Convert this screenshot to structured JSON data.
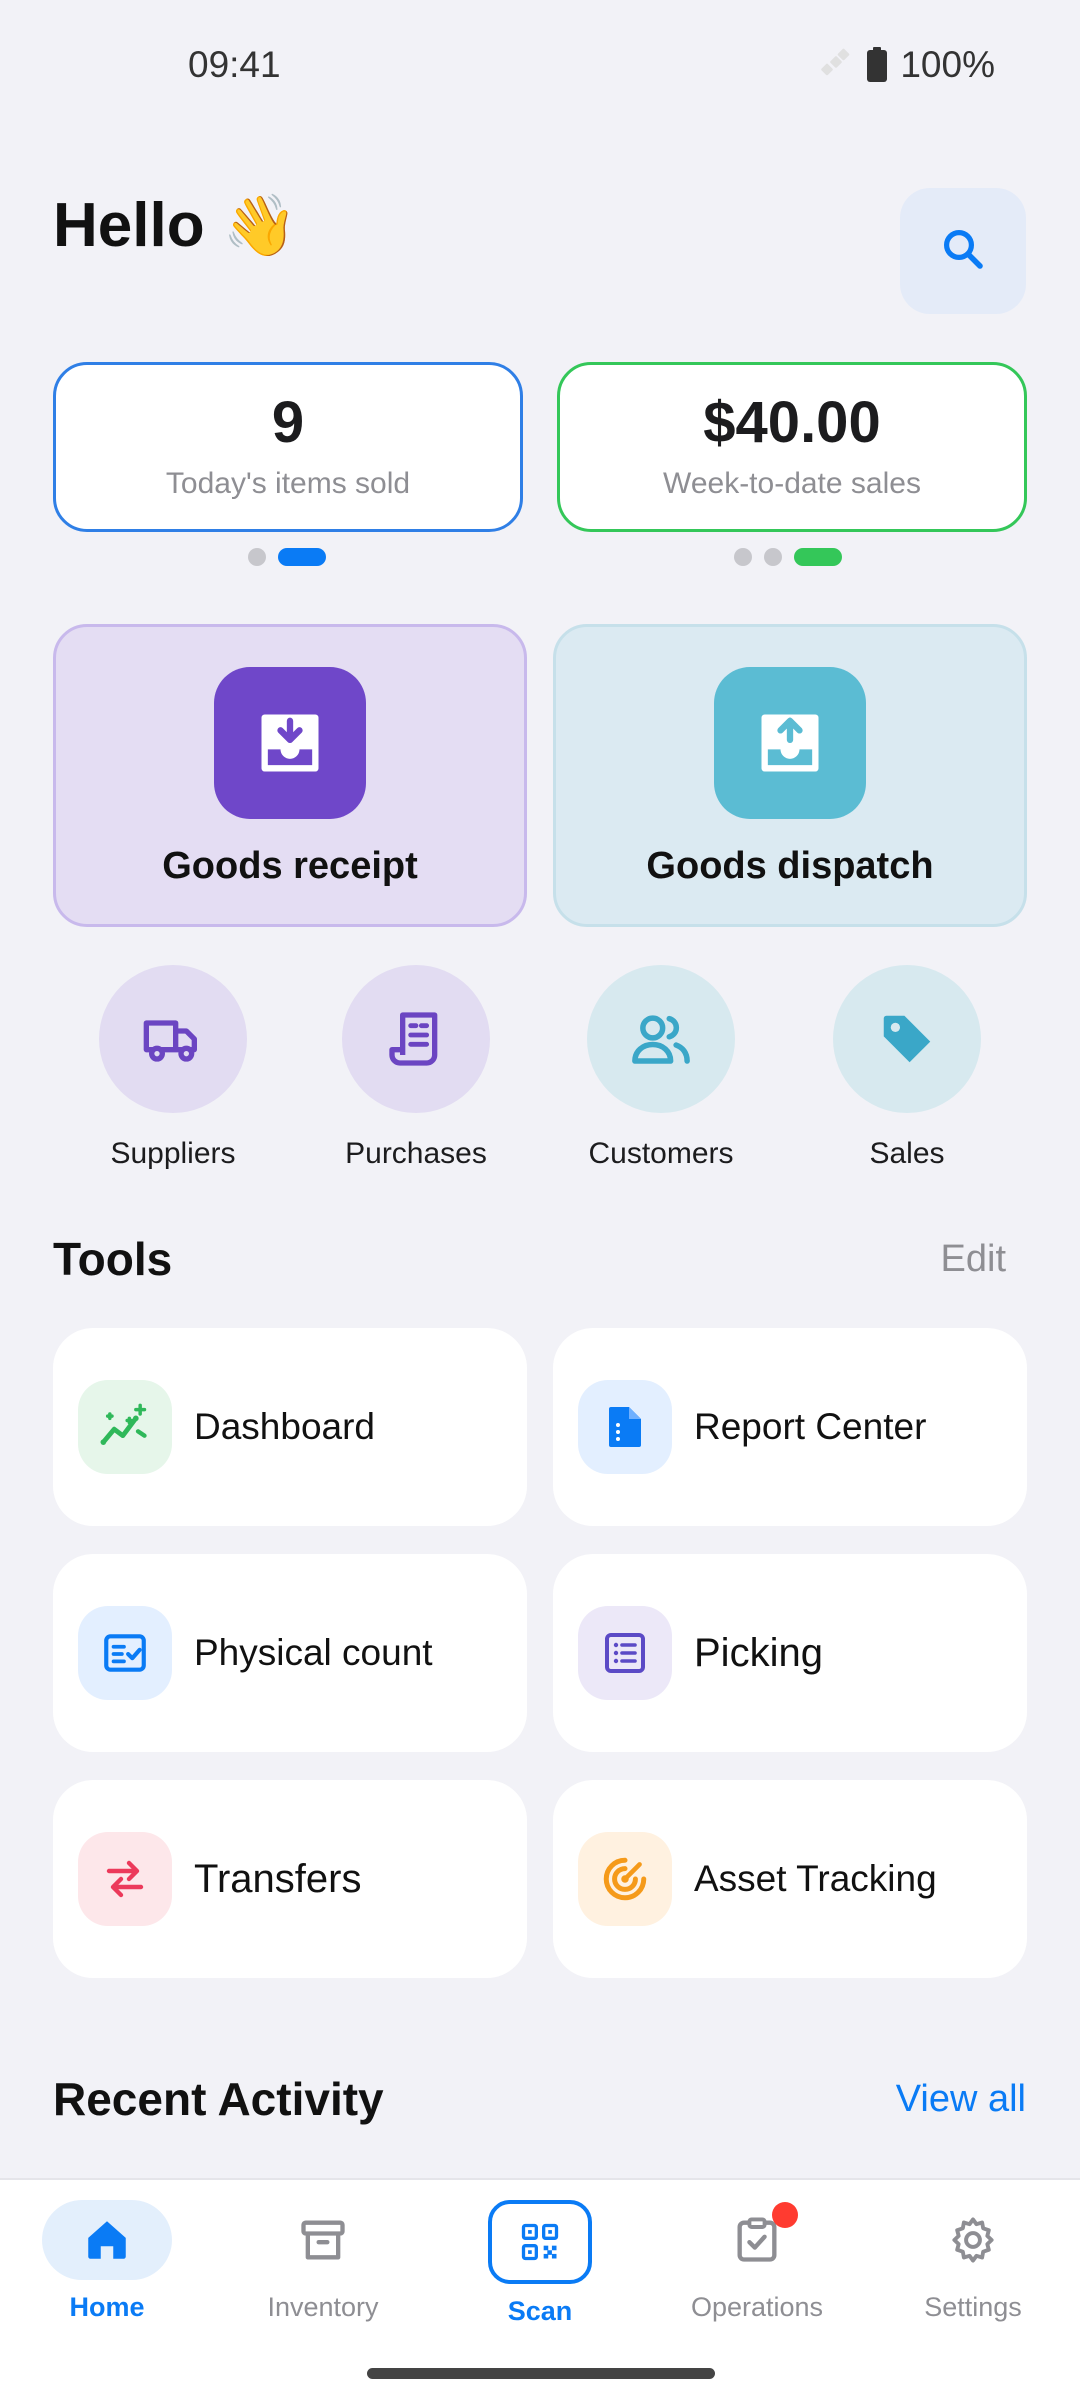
{
  "status_bar": {
    "time": "09:41",
    "battery": "100%"
  },
  "header": {
    "greeting": "Hello",
    "emoji": "👋"
  },
  "stats": [
    {
      "value": "9",
      "label": "Today's items sold"
    },
    {
      "value": "$40.00",
      "label": "Week-to-date sales"
    }
  ],
  "actions": {
    "receipt": "Goods receipt",
    "dispatch": "Goods dispatch"
  },
  "shortcuts": [
    "Suppliers",
    "Purchases",
    "Customers",
    "Sales"
  ],
  "tools": {
    "title": "Tools",
    "edit_label": "Edit",
    "items": [
      "Dashboard",
      "Report Center",
      "Physical count",
      "Picking",
      "Transfers",
      "Asset Tracking"
    ]
  },
  "recent": {
    "title": "Recent Activity",
    "view_all": "View all"
  },
  "nav": {
    "items": [
      "Home",
      "Inventory",
      "Scan",
      "Operations",
      "Settings"
    ],
    "active": "Home"
  },
  "colors": {
    "accent": "#0a7bf5",
    "green": "#34c759",
    "purple": "#6f47c9",
    "teal": "#5bbcd3",
    "badge": "#ff3b30"
  }
}
